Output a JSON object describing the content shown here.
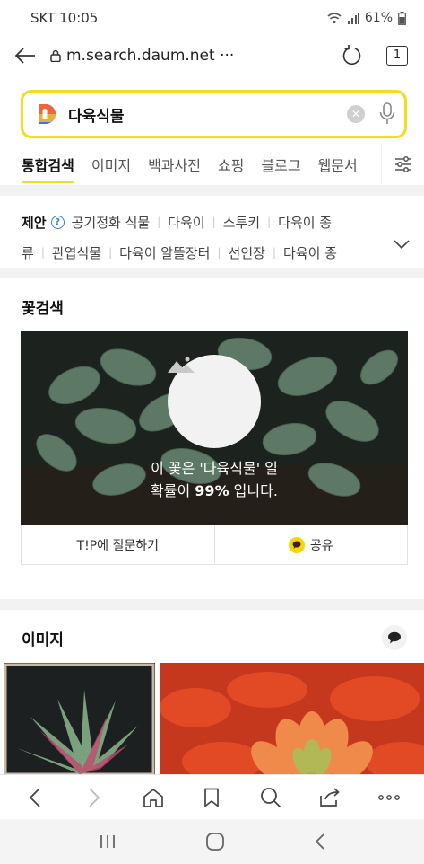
{
  "status_bar": {
    "carrier_time": "SKT 10:05",
    "battery": "61%"
  },
  "browser": {
    "url": "m.search.daum.net ···",
    "tab_count": "1"
  },
  "search": {
    "query": "다육식물"
  },
  "nav_tabs": [
    "통합검색",
    "이미지",
    "백과사전",
    "쇼핑",
    "블로그",
    "웹문서"
  ],
  "suggestions": {
    "title": "제안",
    "line1": [
      "공기정화 식물",
      "다육이",
      "스투키",
      "다육이 종"
    ],
    "line2": [
      "류",
      "관엽식물",
      "다육이 알뜰장터",
      "선인장",
      "다육이 종"
    ]
  },
  "flower_search": {
    "title": "꽃검색",
    "msg_line1": "이 꽃은 '다육식물' 일",
    "msg_prefix": "확률이 ",
    "msg_pct": "99%",
    "msg_suffix": " 입니다.",
    "ask_label": "T!P에 질문하기",
    "share_label": "공유"
  },
  "images": {
    "title": "이미지"
  },
  "colors": {
    "accent_yellow": "#f5dc1e",
    "kakao_yellow": "#f7d600",
    "link_blue": "#3a7bd5"
  }
}
